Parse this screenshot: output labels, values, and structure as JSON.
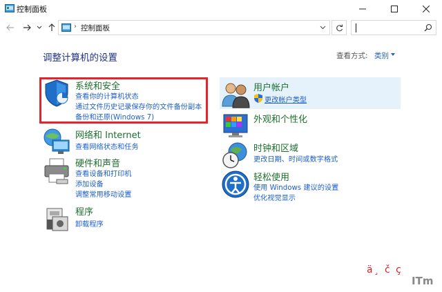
{
  "window": {
    "title": "控制面板"
  },
  "address": {
    "breadcrumb": "控制面板",
    "separator": "›",
    "search_placeholder": ""
  },
  "main": {
    "heading": "调整计算机的设置",
    "view_by_label": "查看方式:",
    "view_by_value": "类别"
  },
  "categories_left": [
    {
      "title": "系统和安全",
      "links": [
        "查看你的计算机状态",
        "通过文件历史记录保存你的文件备份副本",
        "备份和还原(Windows 7)"
      ],
      "icon": "shield-icon"
    },
    {
      "title": "网络和 Internet",
      "links": [
        "查看网络状态和任务"
      ],
      "icon": "network-icon"
    },
    {
      "title": "硬件和声音",
      "links": [
        "查看设备和打印机",
        "添加设备",
        "调整常用移动设置"
      ],
      "icon": "printer-icon"
    },
    {
      "title": "程序",
      "links": [
        "卸载程序"
      ],
      "icon": "programs-icon"
    }
  ],
  "categories_right": [
    {
      "title": "用户帐户",
      "links": [
        "更改帐户类型"
      ],
      "icon": "users-icon"
    },
    {
      "title": "外观和个性化",
      "links": [],
      "icon": "appearance-icon"
    },
    {
      "title": "时钟和区域",
      "links": [
        "更改日期、时间或数字格式"
      ],
      "icon": "clock-globe-icon"
    },
    {
      "title": "轻松使用",
      "links": [
        "使用 Windows 建议的设置",
        "优化视觉显示"
      ],
      "icon": "ease-of-access-icon"
    }
  ],
  "watermark": {
    "text": "ä¸ č ç",
    "brand": "ITm"
  },
  "colors": {
    "title_green": "#1e6f2e",
    "link_blue": "#1e5fcf",
    "heading_navy": "#1e3287",
    "highlight_box": "#e3242b",
    "hover_bg": "#e5f1fb"
  }
}
